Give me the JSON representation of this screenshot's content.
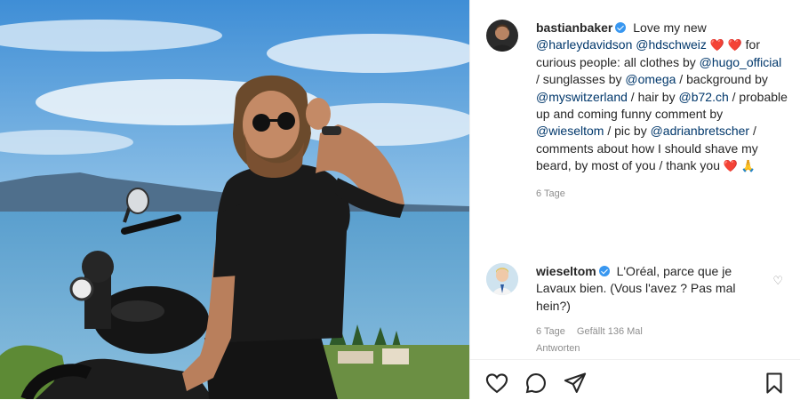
{
  "post": {
    "author": {
      "username": "bastianbaker",
      "verified": true
    },
    "caption_parts": {
      "t1": "Love my new",
      "m1": "@harleydavidson",
      "m2": "@hdschweiz",
      "e1": "❤️ ❤️",
      "t2": "for curious people: all clothes by",
      "m3": "@hugo_official",
      "t3": " / sunglasses by",
      "m4": "@omega",
      "t4": " / background by",
      "m5": "@myswitzerland",
      "t5": " / hair by ",
      "m6": "@b72.ch",
      "t6": " / probable up and coming funny comment by ",
      "m7": "@wieseltom",
      "t7": " / pic by",
      "m8": "@adrianbretscher",
      "t8": " / comments about how I should shave my beard, by most of you / thank you ",
      "e2": "❤️ 🙏"
    },
    "timestamp": "6 Tage"
  },
  "comment": {
    "username": "wieseltom",
    "verified": true,
    "text": "L'Oréal, parce que je Lavaux bien. (Vous l'avez ? Pas mal hein?)",
    "time": "6 Tage",
    "likes": "Gefällt 136 Mal",
    "replies_label": "Antworten"
  },
  "icons": [
    "heart-icon",
    "comment-icon",
    "share-icon",
    "bookmark-icon"
  ],
  "colors": {
    "verified": "#3897f0",
    "mention": "#00376b",
    "muted": "#8e8e8e",
    "text": "#262626"
  }
}
